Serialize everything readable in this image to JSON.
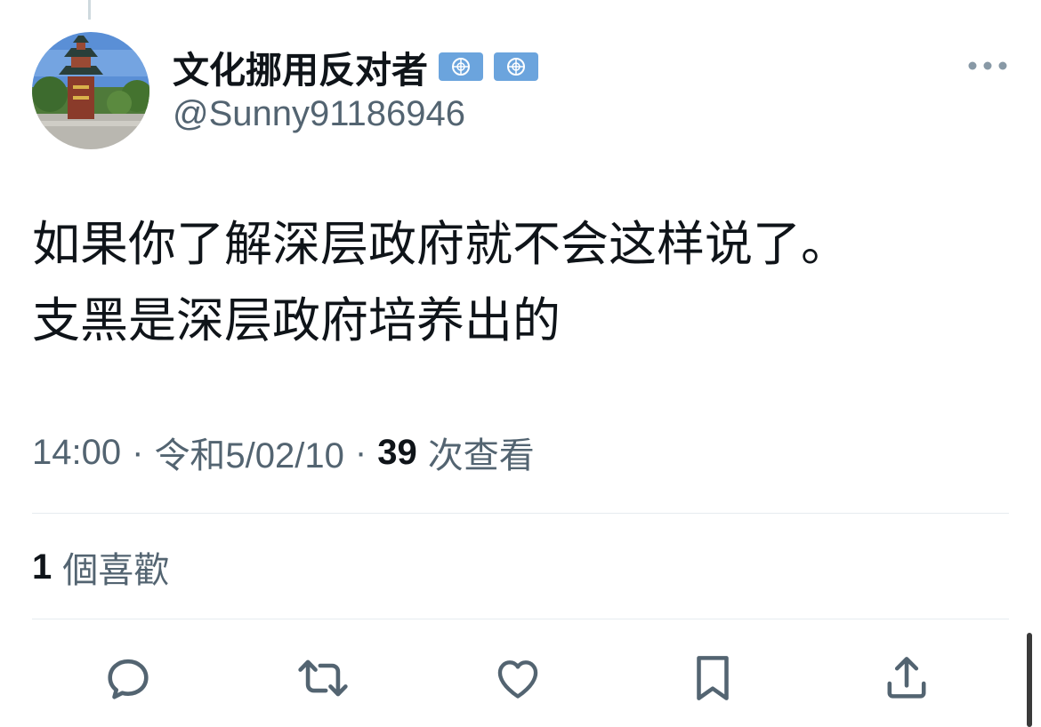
{
  "author": {
    "display_name": "文化挪用反对者",
    "handle": "@Sunny91186946",
    "badges": [
      "un-flag-icon",
      "un-flag-icon"
    ]
  },
  "tweet": {
    "lines": [
      "如果你了解深层政府就不会这样说了。",
      "支黑是深层政府培养出的"
    ]
  },
  "meta": {
    "time": "14:00",
    "separator": "·",
    "date": "令和5/02/10",
    "views_count": "39",
    "views_label": "次查看"
  },
  "engagement": {
    "likes_count": "1",
    "likes_label": "個喜歡"
  },
  "actions": [
    "reply-icon",
    "retweet-icon",
    "like-icon",
    "bookmark-icon",
    "share-icon"
  ],
  "colors": {
    "text_primary": "#0f1419",
    "text_secondary": "#536471",
    "divider": "#e6ecf0",
    "flag_blue": "#6ba4dd"
  }
}
